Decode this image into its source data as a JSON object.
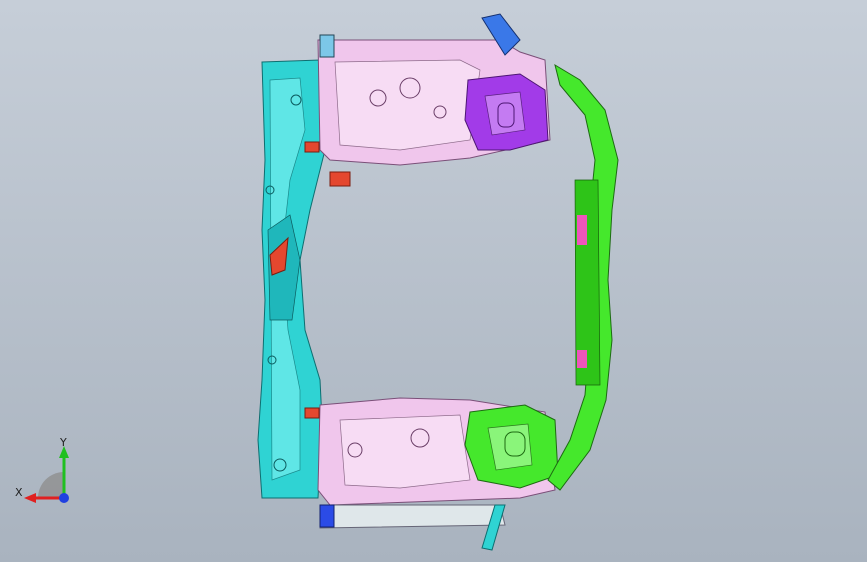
{
  "viewport": {
    "background_top": "#c6ced8",
    "background_bottom": "#a9b3bf"
  },
  "model": {
    "parts": [
      {
        "name": "radiator-support-frame-left",
        "color": "#2fd3d3"
      },
      {
        "name": "front-rail-upper",
        "color": "#f0c6ec"
      },
      {
        "name": "front-rail-lower",
        "color": "#f0c6ec"
      },
      {
        "name": "shock-tower-upper",
        "color": "#a23be8"
      },
      {
        "name": "shock-tower-lower",
        "color": "#45e82c"
      },
      {
        "name": "bumper-beam-arc",
        "color": "#45e82c"
      },
      {
        "name": "bracket-red",
        "color": "#e4472f"
      },
      {
        "name": "corner-marker-blue",
        "color": "#2b4be6"
      }
    ]
  },
  "triad": {
    "x_label": "X",
    "y_label": "Y",
    "x_color": "#e02020",
    "y_color": "#20c020",
    "z_color": "#2040e0"
  }
}
